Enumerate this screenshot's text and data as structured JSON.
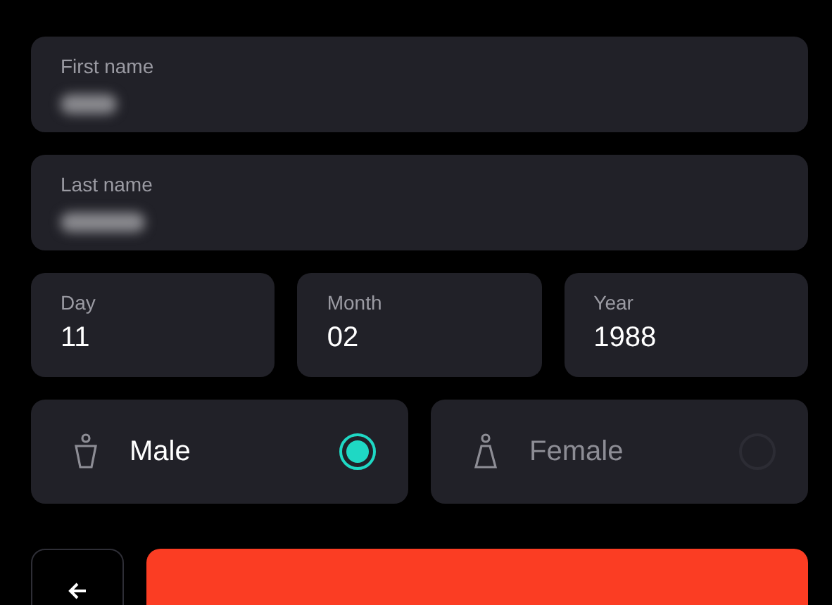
{
  "name_fields": [
    {
      "label": "First name"
    },
    {
      "label": "Last name"
    }
  ],
  "birth_fields": [
    {
      "label": "Day",
      "value": "11"
    },
    {
      "label": "Month",
      "value": "02"
    },
    {
      "label": "Year",
      "value": "1988"
    }
  ],
  "gender_options": [
    {
      "kind": "male",
      "label": "Male",
      "selected": true
    },
    {
      "kind": "female",
      "label": "Female",
      "selected": false
    }
  ]
}
